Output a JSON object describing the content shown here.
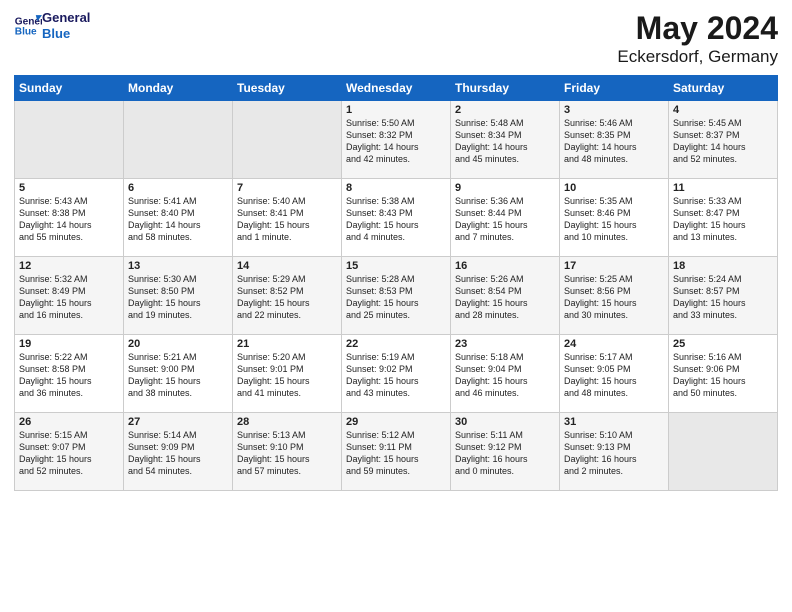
{
  "header": {
    "logo_line1": "General",
    "logo_line2": "Blue",
    "title": "May 2024",
    "subtitle": "Eckersdorf, Germany"
  },
  "days_of_week": [
    "Sunday",
    "Monday",
    "Tuesday",
    "Wednesday",
    "Thursday",
    "Friday",
    "Saturday"
  ],
  "weeks": [
    [
      {
        "day": "",
        "info": ""
      },
      {
        "day": "",
        "info": ""
      },
      {
        "day": "",
        "info": ""
      },
      {
        "day": "1",
        "info": "Sunrise: 5:50 AM\nSunset: 8:32 PM\nDaylight: 14 hours\nand 42 minutes."
      },
      {
        "day": "2",
        "info": "Sunrise: 5:48 AM\nSunset: 8:34 PM\nDaylight: 14 hours\nand 45 minutes."
      },
      {
        "day": "3",
        "info": "Sunrise: 5:46 AM\nSunset: 8:35 PM\nDaylight: 14 hours\nand 48 minutes."
      },
      {
        "day": "4",
        "info": "Sunrise: 5:45 AM\nSunset: 8:37 PM\nDaylight: 14 hours\nand 52 minutes."
      }
    ],
    [
      {
        "day": "5",
        "info": "Sunrise: 5:43 AM\nSunset: 8:38 PM\nDaylight: 14 hours\nand 55 minutes."
      },
      {
        "day": "6",
        "info": "Sunrise: 5:41 AM\nSunset: 8:40 PM\nDaylight: 14 hours\nand 58 minutes."
      },
      {
        "day": "7",
        "info": "Sunrise: 5:40 AM\nSunset: 8:41 PM\nDaylight: 15 hours\nand 1 minute."
      },
      {
        "day": "8",
        "info": "Sunrise: 5:38 AM\nSunset: 8:43 PM\nDaylight: 15 hours\nand 4 minutes."
      },
      {
        "day": "9",
        "info": "Sunrise: 5:36 AM\nSunset: 8:44 PM\nDaylight: 15 hours\nand 7 minutes."
      },
      {
        "day": "10",
        "info": "Sunrise: 5:35 AM\nSunset: 8:46 PM\nDaylight: 15 hours\nand 10 minutes."
      },
      {
        "day": "11",
        "info": "Sunrise: 5:33 AM\nSunset: 8:47 PM\nDaylight: 15 hours\nand 13 minutes."
      }
    ],
    [
      {
        "day": "12",
        "info": "Sunrise: 5:32 AM\nSunset: 8:49 PM\nDaylight: 15 hours\nand 16 minutes."
      },
      {
        "day": "13",
        "info": "Sunrise: 5:30 AM\nSunset: 8:50 PM\nDaylight: 15 hours\nand 19 minutes."
      },
      {
        "day": "14",
        "info": "Sunrise: 5:29 AM\nSunset: 8:52 PM\nDaylight: 15 hours\nand 22 minutes."
      },
      {
        "day": "15",
        "info": "Sunrise: 5:28 AM\nSunset: 8:53 PM\nDaylight: 15 hours\nand 25 minutes."
      },
      {
        "day": "16",
        "info": "Sunrise: 5:26 AM\nSunset: 8:54 PM\nDaylight: 15 hours\nand 28 minutes."
      },
      {
        "day": "17",
        "info": "Sunrise: 5:25 AM\nSunset: 8:56 PM\nDaylight: 15 hours\nand 30 minutes."
      },
      {
        "day": "18",
        "info": "Sunrise: 5:24 AM\nSunset: 8:57 PM\nDaylight: 15 hours\nand 33 minutes."
      }
    ],
    [
      {
        "day": "19",
        "info": "Sunrise: 5:22 AM\nSunset: 8:58 PM\nDaylight: 15 hours\nand 36 minutes."
      },
      {
        "day": "20",
        "info": "Sunrise: 5:21 AM\nSunset: 9:00 PM\nDaylight: 15 hours\nand 38 minutes."
      },
      {
        "day": "21",
        "info": "Sunrise: 5:20 AM\nSunset: 9:01 PM\nDaylight: 15 hours\nand 41 minutes."
      },
      {
        "day": "22",
        "info": "Sunrise: 5:19 AM\nSunset: 9:02 PM\nDaylight: 15 hours\nand 43 minutes."
      },
      {
        "day": "23",
        "info": "Sunrise: 5:18 AM\nSunset: 9:04 PM\nDaylight: 15 hours\nand 46 minutes."
      },
      {
        "day": "24",
        "info": "Sunrise: 5:17 AM\nSunset: 9:05 PM\nDaylight: 15 hours\nand 48 minutes."
      },
      {
        "day": "25",
        "info": "Sunrise: 5:16 AM\nSunset: 9:06 PM\nDaylight: 15 hours\nand 50 minutes."
      }
    ],
    [
      {
        "day": "26",
        "info": "Sunrise: 5:15 AM\nSunset: 9:07 PM\nDaylight: 15 hours\nand 52 minutes."
      },
      {
        "day": "27",
        "info": "Sunrise: 5:14 AM\nSunset: 9:09 PM\nDaylight: 15 hours\nand 54 minutes."
      },
      {
        "day": "28",
        "info": "Sunrise: 5:13 AM\nSunset: 9:10 PM\nDaylight: 15 hours\nand 57 minutes."
      },
      {
        "day": "29",
        "info": "Sunrise: 5:12 AM\nSunset: 9:11 PM\nDaylight: 15 hours\nand 59 minutes."
      },
      {
        "day": "30",
        "info": "Sunrise: 5:11 AM\nSunset: 9:12 PM\nDaylight: 16 hours\nand 0 minutes."
      },
      {
        "day": "31",
        "info": "Sunrise: 5:10 AM\nSunset: 9:13 PM\nDaylight: 16 hours\nand 2 minutes."
      },
      {
        "day": "",
        "info": ""
      }
    ]
  ]
}
